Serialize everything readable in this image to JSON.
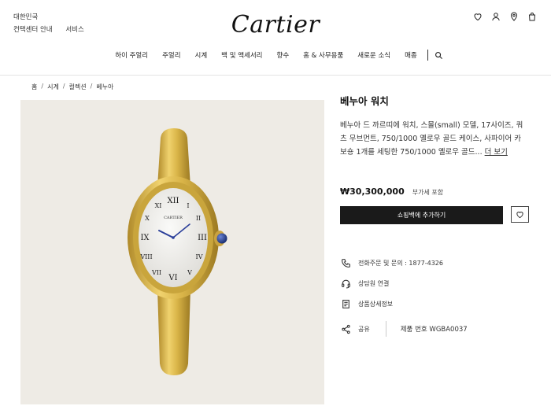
{
  "header": {
    "region": "대한민국",
    "links": [
      "컨택센터 안내",
      "서비스"
    ],
    "logo": "Cartier",
    "icons": [
      "heart-icon",
      "user-icon",
      "location-icon",
      "bag-icon"
    ]
  },
  "nav": {
    "items": [
      "하이 주얼리",
      "주얼리",
      "시계",
      "백 및 액세서리",
      "향수",
      "홈 & 사무용품",
      "새로운 소식",
      "매종"
    ]
  },
  "breadcrumb": [
    "홈",
    "시계",
    "컬렉션",
    "베누아"
  ],
  "product": {
    "title": "베누아 워치",
    "description": "베누아 드 까르띠에 워치, 스몰(small) 모델, 17사이즈, 쿼츠 무브먼트, 750/1000 옐로우 골드 케이스, 사파이어 카보숑 1개를 세팅한 750/1000 옐로우 골드...",
    "more": "더 보기",
    "price": "₩30,300,000",
    "vat": "부가세 포함",
    "add_to_bag": "쇼핑백에 추가하기",
    "dial_brand": "CARTIER"
  },
  "info": {
    "phone": "전화주문 및 문의 : 1877-4326",
    "chat": "상담원 연결",
    "details": "상품상세정보",
    "share": "공유",
    "product_code": "제품 번호 WGBA0037"
  },
  "colors": {
    "gold": "#d7b24a",
    "background": "#eeebe5",
    "button": "#1a1a1a",
    "hands": "#2b3f9a",
    "cabochon": "#233c8e"
  }
}
